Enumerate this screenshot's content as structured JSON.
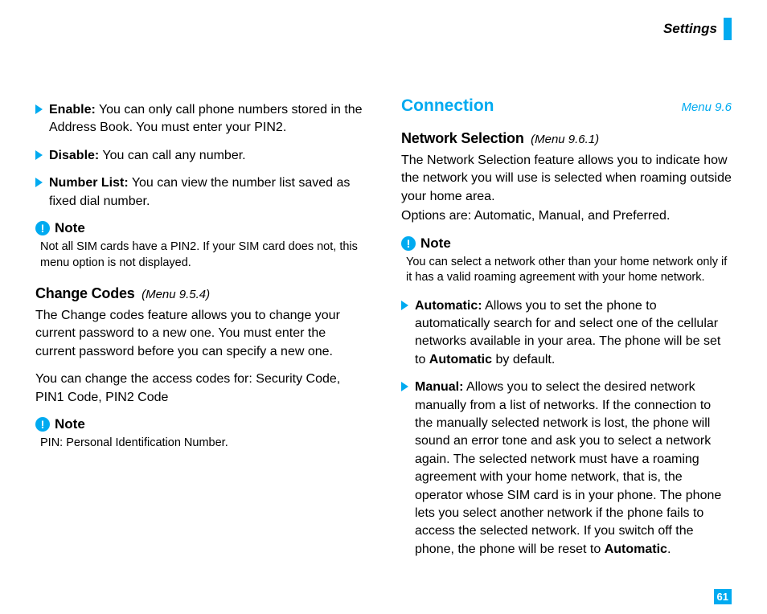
{
  "header": {
    "title": "Settings"
  },
  "left": {
    "bullets": [
      {
        "label": "Enable:",
        "text": "You can only call phone numbers stored in the Address Book. You must enter your PIN2."
      },
      {
        "label": "Disable:",
        "text": "You can call any number."
      },
      {
        "label": "Number List:",
        "text": "You can view the number list saved as fixed dial number."
      }
    ],
    "note1": {
      "label": "Note",
      "text": "Not all SIM cards have a PIN2. If your SIM card does not, this menu option is not displayed."
    },
    "change": {
      "heading": "Change Codes",
      "menu": "(Menu 9.5.4)",
      "para1": "The Change codes feature allows you to change your current password to a new one. You must enter the current password before you can specify a new one.",
      "para2_before": "You can change the access codes for: ",
      "para2_bold": "Security Code",
      "para2_mid": ", ",
      "para2_bold2": "PIN1 Code",
      "para2_mid2": ", ",
      "para2_bold3": "PIN2 Code"
    },
    "note2": {
      "label": "Note",
      "pin_label": "PIN:",
      "pin_text": " Personal Identification Number."
    }
  },
  "right": {
    "section": {
      "title": "Connection",
      "menu": "Menu 9.6"
    },
    "netsel": {
      "heading": "Network Selection",
      "menu": "(Menu 9.6.1)",
      "para": "The Network Selection feature allows you to indicate how the network you will use is selected when roaming outside your home area.",
      "para2": "Options are: Automatic, Manual, and Preferred."
    },
    "note": {
      "label": "Note",
      "text": "You can select a network other than your home network only if it has a valid roaming agreement with your home network."
    },
    "auto": {
      "label": "Automatic:",
      "pre": "Allows you to set the phone to automatically search for and select one of the cellular networks available in your area. The phone will be set to ",
      "bold": "Automatic",
      "post": " by default."
    },
    "manual": {
      "label": "Manual:",
      "pre": "Allows you to select the desired network manually from a list of networks. If the connection to the manually selected network is lost, the phone will sound an error tone and ask you to select a network again. The selected network must have a roaming agreement with your home network, that is, the operator whose SIM card is in your phone. The phone lets you select another network if the phone fails to access the selected network. If you switch off the phone, the phone will be reset to ",
      "bold": "Automatic",
      "post": "."
    }
  },
  "page": "61"
}
